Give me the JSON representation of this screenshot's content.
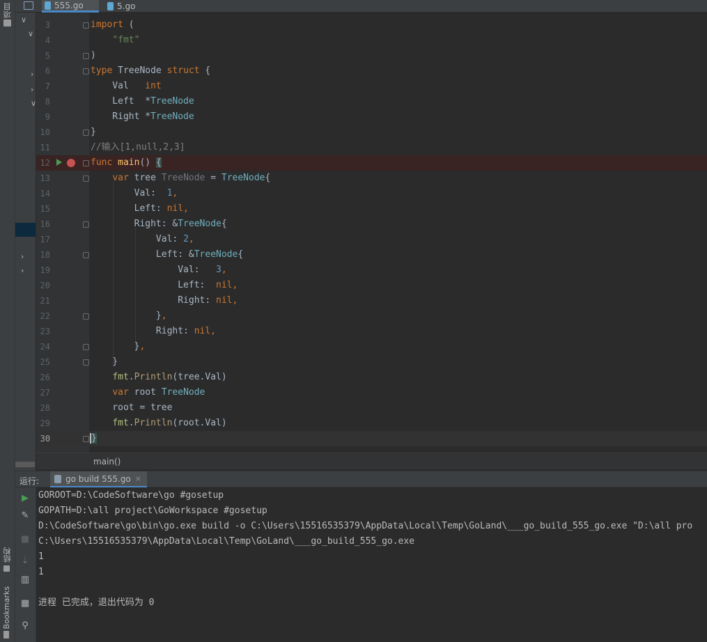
{
  "tabs": [
    {
      "label": "555.go",
      "active": true
    },
    {
      "label": "5.go",
      "active": false
    }
  ],
  "side_tabs": {
    "project": "项目",
    "structure": "结构",
    "bookmarks": "Bookmarks"
  },
  "editor": {
    "line_numbers": [
      "3",
      "4",
      "5",
      "6",
      "7",
      "8",
      "9",
      "10",
      "11",
      "12",
      "13",
      "14",
      "15",
      "16",
      "17",
      "18",
      "19",
      "20",
      "21",
      "22",
      "23",
      "24",
      "25",
      "26",
      "27",
      "28",
      "29",
      "30"
    ],
    "current_line": "30",
    "breakpoint_line": "12"
  },
  "breadcrumb": "main()",
  "run": {
    "title": "运行:",
    "tab_label": "go build 555.go",
    "tab_close": "×",
    "output": [
      "GOROOT=D:\\CodeSoftware\\go #gosetup",
      "GOPATH=D:\\all project\\GoWorkspace #gosetup",
      "D:\\CodeSoftware\\go\\bin\\go.exe build -o C:\\Users\\15516535379\\AppData\\Local\\Temp\\GoLand\\___go_build_555_go.exe \"D:\\all pro",
      "C:\\Users\\15516535379\\AppData\\Local\\Temp\\GoLand\\___go_build_555_go.exe",
      "1",
      "1",
      "",
      "进程 已完成，退出代码为 0"
    ]
  },
  "colors": {
    "editor_bg": "#2b2b2b",
    "keyword": "#cc7832",
    "string": "#6a8759",
    "number": "#6897bb",
    "type": "#6fafbd",
    "function": "#ffc66d",
    "breakpoint": "#c75450",
    "run_green": "#499c54"
  }
}
